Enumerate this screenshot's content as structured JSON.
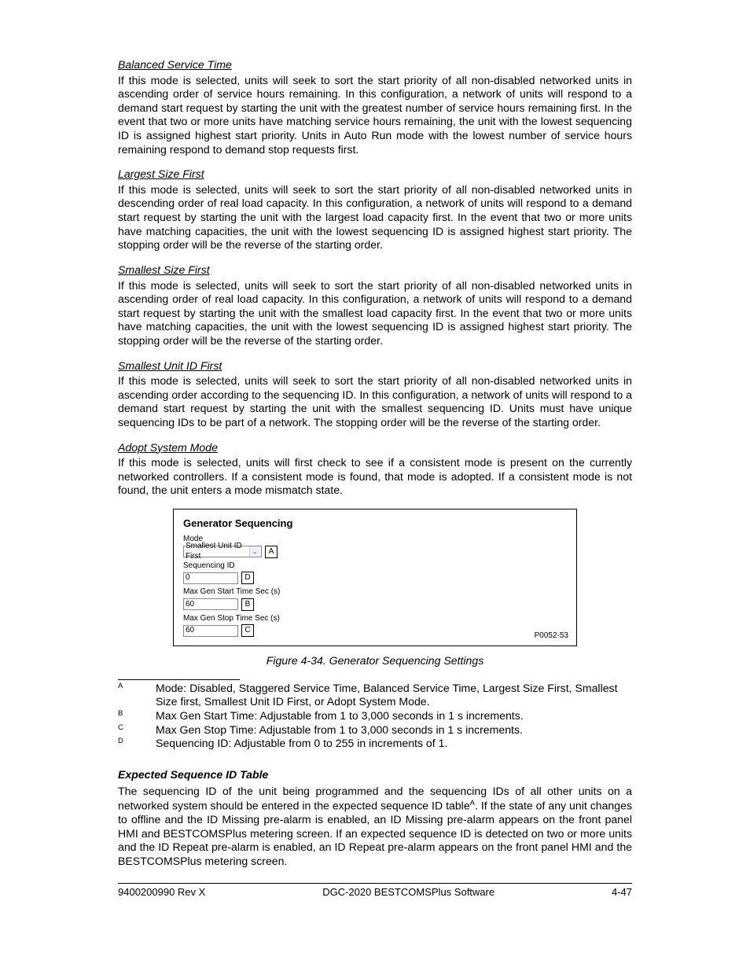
{
  "sections": {
    "s1": {
      "title": "Balanced Service Time",
      "body": "If this mode is selected, units will seek to sort the start priority of all non-disabled networked units in ascending order of service hours remaining. In this configuration, a network of units will respond to a demand start request by starting the unit with the greatest number of service hours remaining first. In the event that two or more units have matching service hours remaining, the unit with the lowest sequencing ID is assigned highest start priority. Units in Auto Run mode with the lowest number of service hours remaining respond to demand stop requests first."
    },
    "s2": {
      "title": "Largest Size First",
      "body": "If this mode is selected, units will seek to sort the start priority of all non-disabled networked units in descending order of real load capacity. In this configuration, a network of units will respond to a demand start request by starting the unit with the largest load capacity first. In the event that two or more units have matching capacities, the unit with the lowest sequencing ID is assigned highest start priority. The stopping order will be the reverse of the starting order."
    },
    "s3": {
      "title": "Smallest Size First",
      "body": "If this mode is selected, units will seek to sort the start priority of all non-disabled networked units in ascending order of real load capacity. In this configuration, a network of units will respond to a demand start request by starting the unit with the smallest load capacity first. In the event that two or more units have matching capacities, the unit with the lowest sequencing ID is assigned highest start priority. The stopping order will be the reverse of the starting order."
    },
    "s4": {
      "title": "Smallest Unit ID First",
      "body": "If this mode is selected, units will seek to sort the start priority of all non-disabled networked units in ascending order according to the sequencing ID. In this configuration, a network of units will respond to a demand start request by starting the unit with the smallest sequencing ID. Units must have unique sequencing IDs to be part of a network. The stopping order will be the reverse of the starting order."
    },
    "s5": {
      "title": "Adopt System Mode",
      "body": "If this mode is selected, units will first check to see if a consistent mode is present on the currently networked controllers. If a consistent mode is found, that mode is adopted. If a consistent mode is not found, the unit enters a mode mismatch state."
    }
  },
  "figure": {
    "title": "Generator Sequencing",
    "fields": {
      "mode": {
        "label": "Mode",
        "value": "Smallest Unit ID First",
        "letter": "A"
      },
      "seqid": {
        "label": "Sequencing ID",
        "value": "0",
        "letter": "D"
      },
      "start": {
        "label": "Max Gen Start Time Sec (s)",
        "value": "60",
        "letter": "B"
      },
      "stop": {
        "label": "Max Gen Stop Time Sec (s)",
        "value": "60",
        "letter": "C"
      }
    },
    "code": "P0052-53",
    "caption": "Figure 4-34. Generator Sequencing Settings"
  },
  "notes": {
    "A": {
      "pre": "Mode: ",
      "body": "Disabled, Staggered Service Time, Balanced Service Time, Largest Size First, Smallest Size first, Smallest Unit ID First, or Adopt System Mode."
    },
    "B": {
      "pre": "Max Gen Start Time: ",
      "body": "Adjustable from 1 to 3,000 seconds in 1 s increments."
    },
    "C": {
      "pre": "Max Gen Stop Time: ",
      "body": "Adjustable from 1 to 3,000 seconds in 1 s increments."
    },
    "D": {
      "pre": "Sequencing ID: ",
      "body": "Adjustable from 0 to 255 in increments of 1."
    }
  },
  "expected": {
    "heading": "Expected Sequence ID Table",
    "body1": "The sequencing ID of the unit being programmed and the sequencing IDs of all other units on a networked system should be entered in the expected sequence ID table",
    "sup": "A",
    "body2": ". If the state of any unit changes to offline and the ID Missing pre-alarm is enabled, an ID Missing pre-alarm appears on the front panel HMI and BESTCOMSPlus metering screen. If an expected sequence ID is detected on two or more units and the ID Repeat pre-alarm is enabled, an ID Repeat pre-alarm appears on the front panel HMI and the BESTCOMSPlus metering screen."
  },
  "footer": {
    "left": "9400200990 Rev X",
    "center": "DGC-2020 BESTCOMSPlus Software",
    "right": "4-47"
  }
}
